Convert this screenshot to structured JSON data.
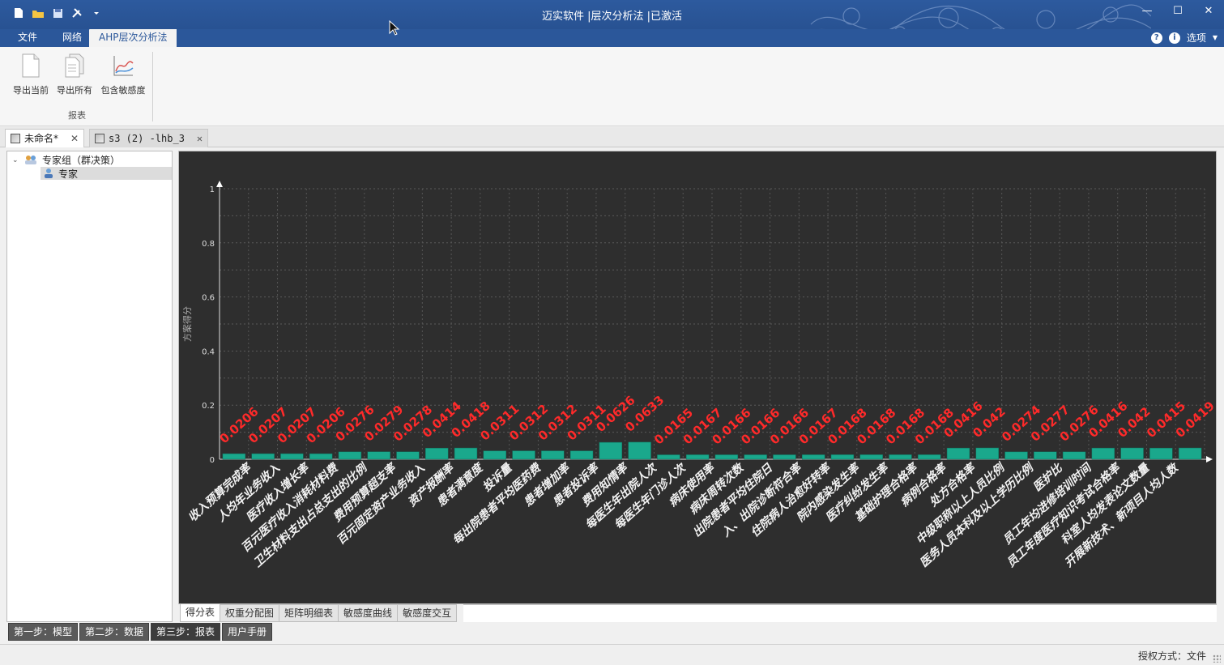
{
  "window": {
    "title": "迈实软件 |层次分析法 |已激活",
    "controls": [
      "minimize-icon",
      "maximize-icon",
      "close-icon"
    ]
  },
  "quick_access": [
    "new-file-icon",
    "open-folder-icon",
    "save-icon",
    "tools-icon",
    "dropdown-icon"
  ],
  "ribbon": {
    "tabs": [
      {
        "label": "文件",
        "active": false
      },
      {
        "label": "网络",
        "active": false
      },
      {
        "label": "AHP层次分析法",
        "active": true
      }
    ],
    "options_label": "选项",
    "buttons": [
      {
        "label": "导出当前",
        "icon": "document-icon"
      },
      {
        "label": "导出所有",
        "icon": "documents-icon"
      },
      {
        "label": "包含敏感度",
        "icon": "chart-icon"
      }
    ],
    "group_label": "报表"
  },
  "doc_tabs": [
    {
      "label": "未命名*",
      "active": true
    },
    {
      "label": "s3 (2) -lhb_3",
      "active": false
    }
  ],
  "tree": {
    "root": "专家组（群决策）",
    "child": "专家"
  },
  "bottom_tabs": [
    {
      "label": "得分表",
      "active": true
    },
    {
      "label": "权重分配图",
      "active": false
    },
    {
      "label": "矩阵明细表",
      "active": false
    },
    {
      "label": "敏感度曲线",
      "active": false
    },
    {
      "label": "敏感度交互",
      "active": false
    }
  ],
  "step_tabs": [
    {
      "label": "第一步：模型",
      "active": false
    },
    {
      "label": "第二步：数据",
      "active": false
    },
    {
      "label": "第三步：报表",
      "active": true
    },
    {
      "label": "用户手册",
      "active": false
    }
  ],
  "status": {
    "auth_text": "授权方式：文件"
  },
  "colors": {
    "title_bar": "#2b579a",
    "chart_bg": "#2e2e2e",
    "bar": "#1aa88c",
    "value_label": "#ff2a2a"
  },
  "chart_data": {
    "type": "bar",
    "ylabel": "方案得分",
    "ylim": [
      0,
      1
    ],
    "yticks": [
      "0",
      "0.2",
      "0.4",
      "0.6",
      "0.8",
      "1"
    ],
    "grid": true,
    "categories": [
      "收入预算完成率",
      "人均年业务收入",
      "医疗收入增长率",
      "百元医疗收入消耗材料费",
      "卫生材料支出占总支出的比例",
      "费用预算超支率",
      "百元固定资产业务收入",
      "资产报酬率",
      "患者满意度",
      "投诉量",
      "每出院患者平均医药费",
      "患者增加率",
      "患者投诉率",
      "费用知情率",
      "每医生年出院人次",
      "每医生年门诊人次",
      "病床使用率",
      "病床周转次数",
      "出院患者平均住院日",
      "入、出院诊断符合率",
      "住院病人治愈好转率",
      "院内感染发生率",
      "医疗纠纷发生率",
      "基础护理合格率",
      "病例合格率",
      "处方合格率",
      "中级职称以上人员比例",
      "医务人员本科及以上学历比例",
      "医护比",
      "员工年均进修培训时间",
      "员工年度医疗知识考试合格率",
      "科室人均发表论文数量",
      "开展新技术、新项目人均人数"
    ],
    "values": [
      0.0206,
      0.0207,
      0.0207,
      0.0206,
      0.0276,
      0.0279,
      0.0278,
      0.0414,
      0.0418,
      0.0311,
      0.0312,
      0.0312,
      0.0311,
      0.0626,
      0.0633,
      0.0165,
      0.0167,
      0.0166,
      0.0166,
      0.0166,
      0.0167,
      0.0168,
      0.0168,
      0.0168,
      0.0168,
      0.0416,
      0.042,
      0.0274,
      0.0277,
      0.0276,
      0.0416,
      0.042,
      0.0415,
      0.0419
    ],
    "value_labels": [
      "0.0206",
      "0.0207",
      "0.0207",
      "0.0206",
      "0.0276",
      "0.0279",
      "0.0278",
      "0.0414",
      "0.0418",
      "0.0311",
      "0.0312",
      "0.0312",
      "0.0311",
      "0.0626",
      "0.0633",
      "0.0165",
      "0.0167",
      "0.0166",
      "0.0166",
      "0.0166",
      "0.0167",
      "0.0168",
      "0.0168",
      "0.0168",
      "0.0168",
      "0.0416",
      "0.042",
      "0.0274",
      "0.0277",
      "0.0276",
      "0.0416",
      "0.042",
      "0.0415",
      "0.0419"
    ]
  }
}
